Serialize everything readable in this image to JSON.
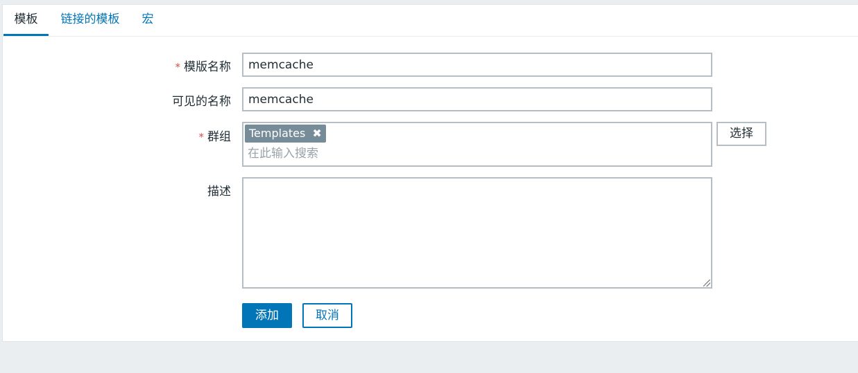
{
  "tabs": [
    {
      "label": "模板",
      "active": true
    },
    {
      "label": "链接的模板",
      "active": false
    },
    {
      "label": "宏",
      "active": false
    }
  ],
  "form": {
    "required_mark": "*",
    "template_name": {
      "label": "模版名称",
      "value": "memcache"
    },
    "visible_name": {
      "label": "可见的名称",
      "value": "memcache"
    },
    "groups": {
      "label": "群组",
      "chips": [
        {
          "label": "Templates"
        }
      ],
      "placeholder": "在此输入搜索",
      "select_label": "选择"
    },
    "description": {
      "label": "描述",
      "value": ""
    }
  },
  "buttons": {
    "add": "添加",
    "cancel": "取消"
  },
  "colors": {
    "accent": "#0275b8",
    "required": "#d64e4e",
    "chip_bg": "#768d99",
    "background": "#ebeef0"
  },
  "icons": {
    "chip_remove": "close-icon"
  }
}
